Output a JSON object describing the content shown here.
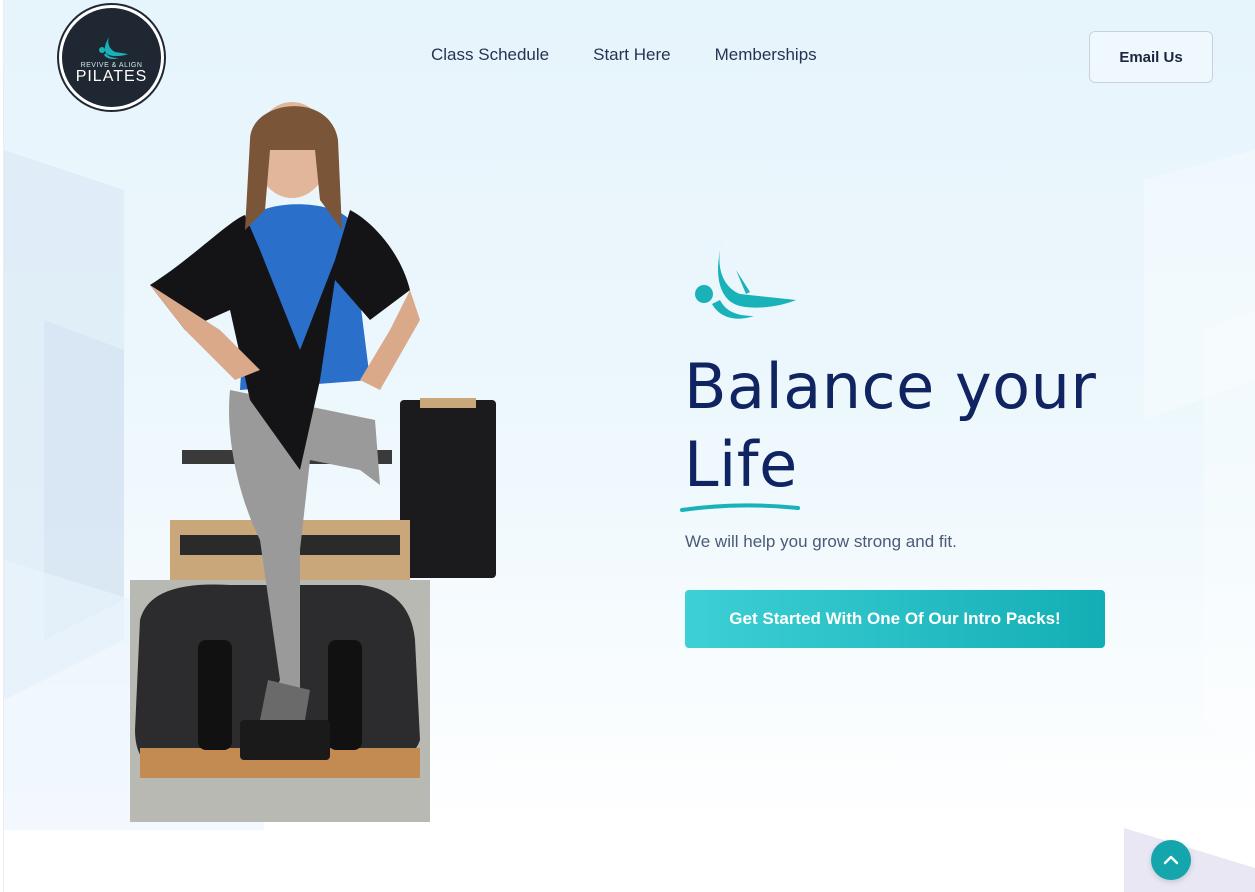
{
  "brand": {
    "logo_subtitle": "REVIVE & ALIGN",
    "logo_title": "PILATES",
    "logo_icon": "pilates-figure-icon",
    "accent_color": "#14a5ad",
    "dark_color": "#1f2733"
  },
  "nav": {
    "items": [
      {
        "label": "Class Schedule"
      },
      {
        "label": "Start Here"
      },
      {
        "label": "Memberships"
      }
    ],
    "email_button": "Email Us"
  },
  "hero": {
    "title_line1": "Balance your",
    "title_line2": "Life",
    "subtitle": "We will help you grow strong and fit.",
    "cta_label": "Get Started With One Of Our Intro Packs!",
    "title_color": "#0f2460"
  },
  "icons": {
    "hero_icon": "pilates-figure-icon",
    "scroll_top": "chevron-up-icon"
  }
}
